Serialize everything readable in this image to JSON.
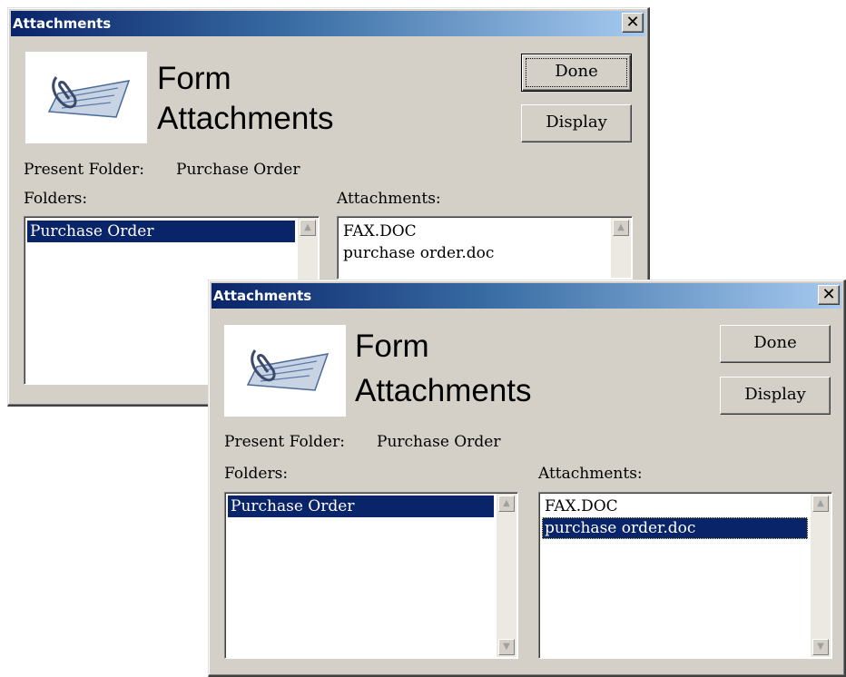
{
  "colors": {
    "face": "#d4d0c8",
    "title_start": "#0a246a",
    "title_end": "#a6caf0",
    "selection": "#0a246a"
  },
  "dialog_back": {
    "title": "Attachments",
    "close_glyph": "✕",
    "heading_line1": "Form",
    "heading_line2": "Attachments",
    "done_label": "Done",
    "display_label": "Display",
    "present_folder_label": "Present Folder:",
    "present_folder_value": "Purchase Order",
    "folders_label": "Folders:",
    "attachments_label": "Attachments:",
    "folders": [
      "Purchase Order"
    ],
    "attachments": [
      "FAX.DOC",
      "purchase order.doc"
    ],
    "scroll_up_icon": "▲"
  },
  "dialog_front": {
    "title": "Attachments",
    "close_glyph": "✕",
    "heading_line1": "Form",
    "heading_line2": "Attachments",
    "done_label": "Done",
    "display_label": "Display",
    "present_folder_label": "Present Folder:",
    "present_folder_value": "Purchase Order",
    "folders_label": "Folders:",
    "attachments_label": "Attachments:",
    "folders": [
      "Purchase Order"
    ],
    "attachments": [
      "FAX.DOC",
      "purchase order.doc"
    ],
    "scroll_up_icon": "▲",
    "scroll_down_icon": "▼"
  }
}
